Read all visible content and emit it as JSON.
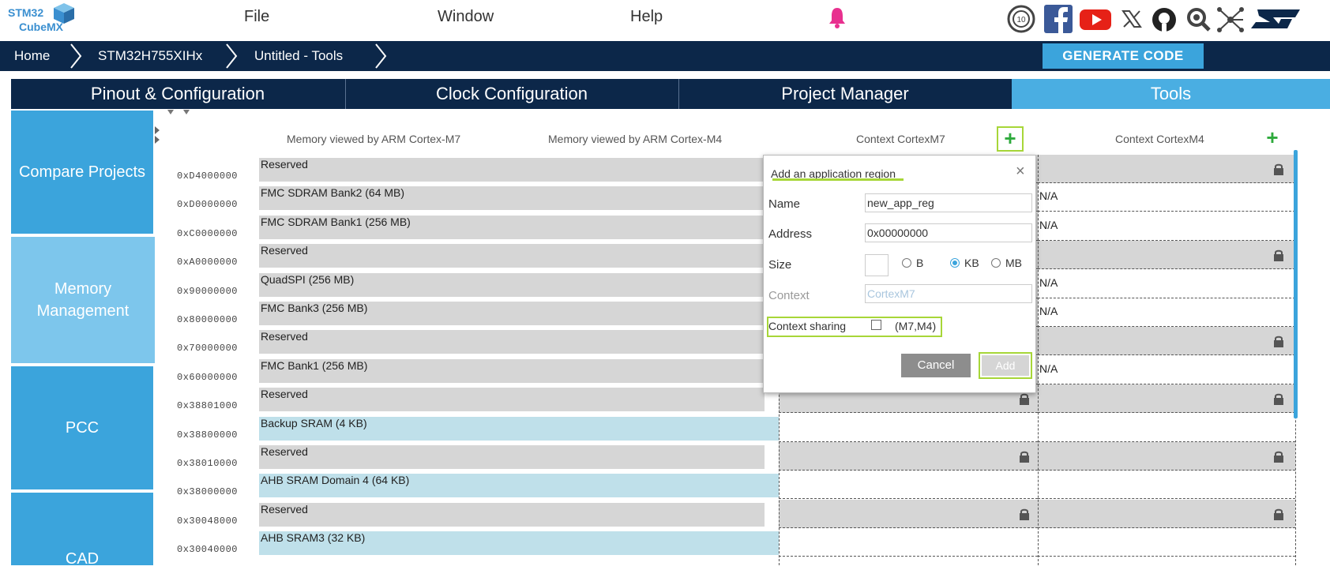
{
  "app": {
    "logo_line1": "STM32",
    "logo_line2": "CubeMX"
  },
  "menu": [
    {
      "label": "File"
    },
    {
      "label": "Window"
    },
    {
      "label": "Help"
    }
  ],
  "breadcrumb": [
    {
      "label": "Home"
    },
    {
      "label": "STM32H755XIHx"
    },
    {
      "label": "Untitled - Tools"
    }
  ],
  "toolbar": {
    "generate_label": "GENERATE CODE"
  },
  "tabs": [
    {
      "label": "Pinout & Configuration"
    },
    {
      "label": "Clock Configuration"
    },
    {
      "label": "Project Manager"
    },
    {
      "label": "Tools",
      "active": true
    }
  ],
  "sidebar": [
    {
      "label": "Compare Projects"
    },
    {
      "label": "Memory Management",
      "active": true
    },
    {
      "label": "PCC"
    },
    {
      "label": "CAD"
    }
  ],
  "columns": {
    "m7": "Memory viewed by ARM Cortex-M7",
    "m4": "Memory viewed by ARM Cortex-M4",
    "ctx_m7": "Context CortexM7",
    "ctx_m4": "Context CortexM4"
  },
  "plus_glyph": "+",
  "na_label": "N/A",
  "regions": [
    {
      "address": "0xD4000000",
      "name": "Reserved",
      "kind": "reserved",
      "ctx_m7": "",
      "ctx_m4": ""
    },
    {
      "address": "0xD0000000",
      "name": "FMC SDRAM Bank2 (64 MB)",
      "kind": "reserved",
      "ctx_m7": "",
      "ctx_m4": "N/A"
    },
    {
      "address": "0xC0000000",
      "name": "FMC SDRAM Bank1 (256 MB)",
      "kind": "reserved",
      "ctx_m7": "",
      "ctx_m4": "N/A"
    },
    {
      "address": "0xA0000000",
      "name": "Reserved",
      "kind": "reserved",
      "ctx_m7": "",
      "ctx_m4": ""
    },
    {
      "address": "0x90000000",
      "name": "QuadSPI (256 MB)",
      "kind": "reserved",
      "ctx_m7": "",
      "ctx_m4": "N/A"
    },
    {
      "address": "0x80000000",
      "name": "FMC Bank3 (256 MB)",
      "kind": "reserved",
      "ctx_m7": "",
      "ctx_m4": "N/A"
    },
    {
      "address": "0x70000000",
      "name": "Reserved",
      "kind": "reserved",
      "ctx_m7": "",
      "ctx_m4": ""
    },
    {
      "address": "0x60000000",
      "name": "FMC Bank1 (256 MB)",
      "kind": "reserved",
      "ctx_m7": "",
      "ctx_m4": "N/A"
    },
    {
      "address": "0x38801000",
      "name": "Reserved",
      "kind": "reserved",
      "ctx_m7": "",
      "ctx_m4": ""
    },
    {
      "address": "0x38800000",
      "name": "Backup SRAM (4 KB)",
      "kind": "memory",
      "ctx_m7": "",
      "ctx_m4": ""
    },
    {
      "address": "0x38010000",
      "name": "Reserved",
      "kind": "reserved",
      "ctx_m7": "",
      "ctx_m4": ""
    },
    {
      "address": "0x38000000",
      "name": "AHB SRAM Domain 4 (64 KB)",
      "kind": "memory",
      "ctx_m7": "",
      "ctx_m4": ""
    },
    {
      "address": "0x30048000",
      "name": "Reserved",
      "kind": "reserved",
      "ctx_m7": "",
      "ctx_m4": ""
    },
    {
      "address": "0x30040000",
      "name": "AHB SRAM3 (32 KB)",
      "kind": "memory",
      "ctx_m7": "",
      "ctx_m4": ""
    }
  ],
  "dialog": {
    "title": "Add an application region",
    "close_glyph": "×",
    "name_label": "Name",
    "name_value": "new_app_reg",
    "address_label": "Address",
    "address_value": "0x00000000",
    "size_label": "Size",
    "size_value": "",
    "units": [
      {
        "label": "B",
        "selected": false
      },
      {
        "label": "KB",
        "selected": true
      },
      {
        "label": "MB",
        "selected": false
      }
    ],
    "context_label": "Context",
    "context_value": "CortexM7",
    "sharing_label": "Context sharing",
    "sharing_cores": "(M7,M4)",
    "cancel_label": "Cancel",
    "add_label": "Add"
  },
  "colors": {
    "nav_dark": "#0c2749",
    "accent": "#3ba4dc",
    "highlight": "#a7d638",
    "reserved_bg": "#d6d6d6",
    "memory_bg": "#bfe0ea"
  }
}
